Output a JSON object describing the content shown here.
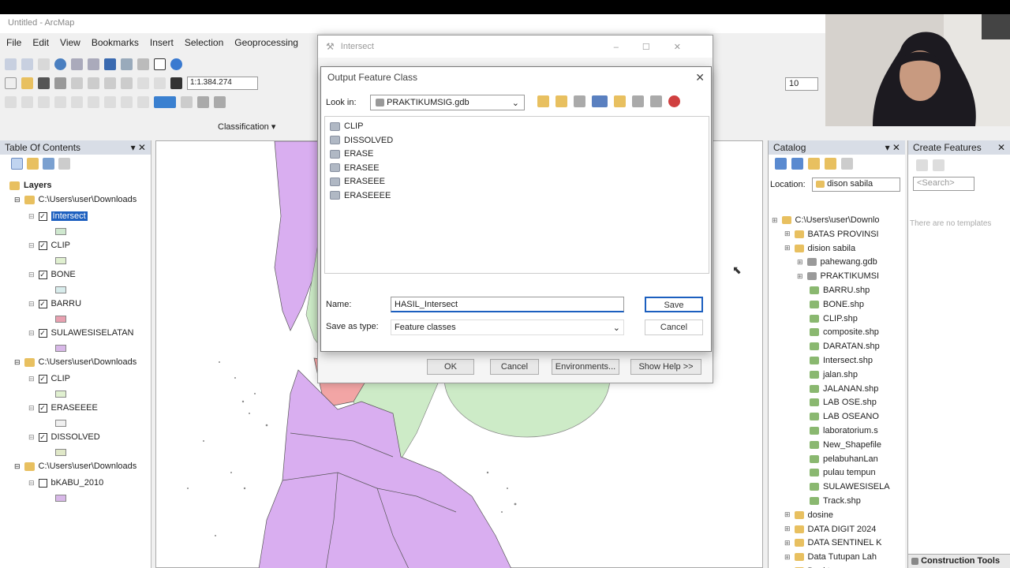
{
  "app": {
    "title": "Untitled - ArcMap",
    "menu": [
      "File",
      "Edit",
      "View",
      "Bookmarks",
      "Insert",
      "Selection",
      "Geoprocessing"
    ],
    "scale": "1:1.384.274",
    "font_size": "10",
    "classification": "Classification ▾"
  },
  "toc": {
    "title": "Table Of Contents",
    "root": "Layers",
    "groups": [
      {
        "path": "C:\\Users\\user\\Downloads",
        "layers": [
          {
            "name": "Intersect",
            "checked": true,
            "color": "#cfe8cf"
          },
          {
            "name": "CLIP",
            "checked": true,
            "color": "#e0f0d0"
          },
          {
            "name": "BONE",
            "checked": true,
            "color": "#d8ecec"
          },
          {
            "name": "BARRU",
            "checked": true,
            "color": "#e8a0b0"
          },
          {
            "name": "SULAWESISELATAN",
            "checked": true,
            "color": "#d8b8e8"
          }
        ]
      },
      {
        "path": "C:\\Users\\user\\Downloads",
        "layers": [
          {
            "name": "CLIP",
            "checked": true,
            "color": "#e0f0d0"
          },
          {
            "name": "ERASEEEE",
            "checked": true,
            "color": "#f0f0f0"
          },
          {
            "name": "DISSOLVED",
            "checked": true,
            "color": "#e0e8c8"
          }
        ]
      },
      {
        "path": "C:\\Users\\user\\Downloads",
        "layers": [
          {
            "name": "bKABU_2010",
            "checked": false,
            "color": "#d8b8e8"
          }
        ]
      }
    ]
  },
  "catalog": {
    "title": "Catalog",
    "location_label": "Location:",
    "location_value": "dison sabila",
    "items": [
      {
        "label": "C:\\Users\\user\\Downlo",
        "kind": "folder",
        "depth": 0
      },
      {
        "label": "BATAS PROVINSI",
        "kind": "folder",
        "depth": 1
      },
      {
        "label": "dision sabila",
        "kind": "folder",
        "depth": 1
      },
      {
        "label": "pahewang.gdb",
        "kind": "gdb",
        "depth": 2
      },
      {
        "label": "PRAKTIKUMSI",
        "kind": "gdb",
        "depth": 2
      },
      {
        "label": "BARRU.shp",
        "kind": "shp",
        "depth": 3
      },
      {
        "label": "BONE.shp",
        "kind": "shp",
        "depth": 3
      },
      {
        "label": "CLIP.shp",
        "kind": "shp",
        "depth": 3
      },
      {
        "label": "composite.shp",
        "kind": "shp",
        "depth": 3
      },
      {
        "label": "DARATAN.shp",
        "kind": "shp",
        "depth": 3
      },
      {
        "label": "Intersect.shp",
        "kind": "shp",
        "depth": 3
      },
      {
        "label": "jalan.shp",
        "kind": "shp",
        "depth": 3
      },
      {
        "label": "JALANAN.shp",
        "kind": "shp",
        "depth": 3
      },
      {
        "label": "LAB OSE.shp",
        "kind": "shp",
        "depth": 3
      },
      {
        "label": "LAB OSEANO",
        "kind": "shp",
        "depth": 3
      },
      {
        "label": "laboratorium.s",
        "kind": "shp",
        "depth": 3
      },
      {
        "label": "New_Shapefile",
        "kind": "shp",
        "depth": 3
      },
      {
        "label": "pelabuhanLan",
        "kind": "shp",
        "depth": 3
      },
      {
        "label": "pulau tempun",
        "kind": "shp",
        "depth": 3
      },
      {
        "label": "SULAWESISELA",
        "kind": "shp",
        "depth": 3
      },
      {
        "label": "Track.shp",
        "kind": "shp",
        "depth": 3
      },
      {
        "label": "dosine",
        "kind": "folder",
        "depth": 1
      },
      {
        "label": "DATA DIGIT 2024",
        "kind": "folder",
        "depth": 1
      },
      {
        "label": "DATA SENTINEL K",
        "kind": "folder",
        "depth": 1
      },
      {
        "label": "Data Tutupan Lah",
        "kind": "folder",
        "depth": 1
      },
      {
        "label": "Desktop",
        "kind": "folder",
        "depth": 1
      }
    ]
  },
  "create_features": {
    "title": "Create Features",
    "search_placeholder": "<Search>",
    "empty_msg": "There are no templates",
    "construction_tools": "Construction Tools"
  },
  "intersect_dialog": {
    "title": "Intersect",
    "buttons": {
      "ok": "OK",
      "cancel": "Cancel",
      "environments": "Environments...",
      "show_help": "Show Help >>"
    }
  },
  "output_dialog": {
    "title": "Output Feature Class",
    "look_in_label": "Look in:",
    "look_in_value": "PRAKTIKUMSIG.gdb",
    "files": [
      "CLIP",
      "DISSOLVED",
      "ERASE",
      "ERASEE",
      "ERASEEE",
      "ERASEEEE"
    ],
    "name_label": "Name:",
    "name_value": "HASIL_Intersect",
    "save_as_type_label": "Save as type:",
    "save_as_type_value": "Feature classes",
    "save_label": "Save",
    "cancel_label": "Cancel"
  },
  "colors": {
    "purple_region": "#d9aef0",
    "green_region": "#cdebc7",
    "pink_region": "#f2a5a5",
    "selection": "#1c5fbf"
  }
}
